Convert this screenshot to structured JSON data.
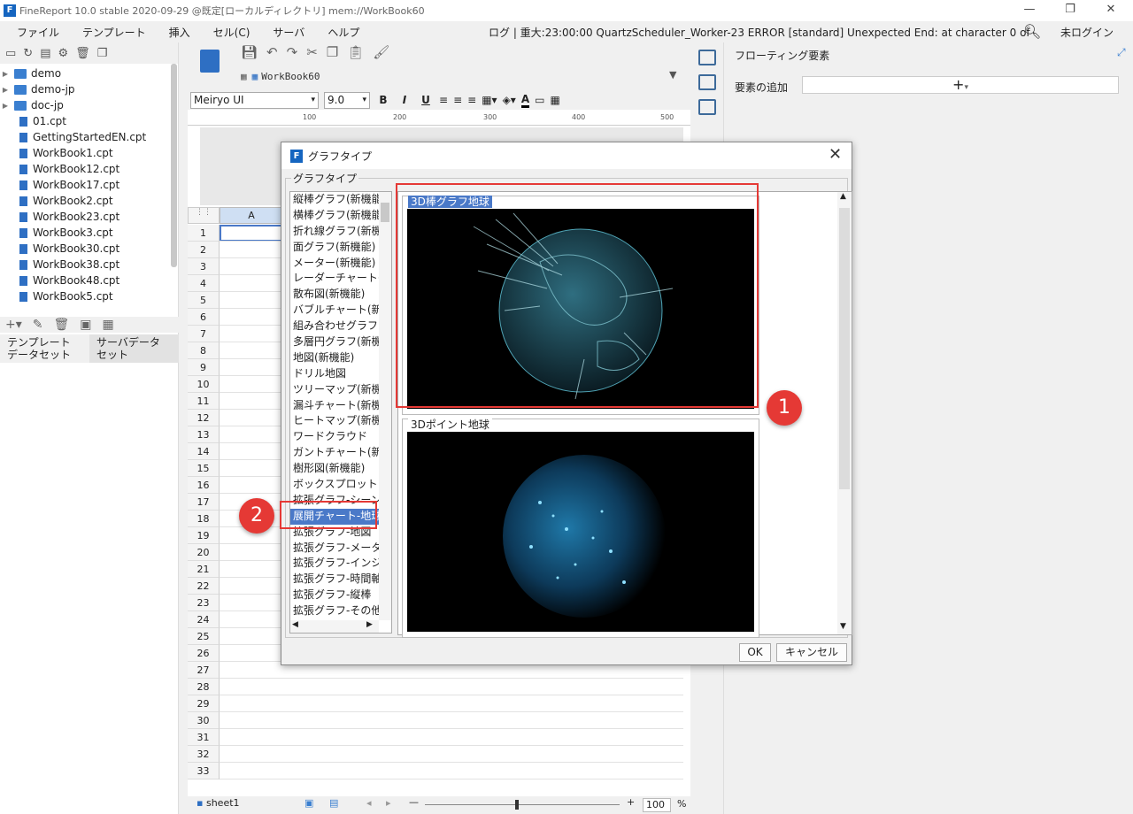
{
  "app": {
    "title": "FineReport 10.0 stable 2020-09-29 @既定[ローカルディレクトリ]    mem://WorkBook60",
    "min_symbol": "—",
    "max_symbol": "❐",
    "close_symbol": "✕"
  },
  "menu": {
    "items": [
      "ファイル",
      "テンプレート",
      "挿入",
      "セル(C)",
      "サーバ",
      "ヘルプ"
    ],
    "log": "ログ | 重大:23:00:00 QuartzScheduler_Worker-23 ERROR [standard] Unexpected End: at character 0 of",
    "login": "未ログイン"
  },
  "tree": {
    "folders": [
      "demo",
      "demo-jp",
      "doc-jp"
    ],
    "files": [
      "01.cpt",
      "GettingStartedEN.cpt",
      "WorkBook1.cpt",
      "WorkBook12.cpt",
      "WorkBook17.cpt",
      "WorkBook2.cpt",
      "WorkBook23.cpt",
      "WorkBook3.cpt",
      "WorkBook30.cpt",
      "WorkBook38.cpt",
      "WorkBook48.cpt",
      "WorkBook5.cpt"
    ]
  },
  "leftTabs": {
    "template_dataset": "テンプレート\nデータセット",
    "server_dataset": "サーバデータ\nセット"
  },
  "editor": {
    "workbook_tab": "WorkBook60",
    "font": "Meiryo UI",
    "font_size": "9.0",
    "bold": "B",
    "italic": "I",
    "underline": "U",
    "ruler_labels": [
      "100",
      "200",
      "300",
      "400",
      "500"
    ],
    "col_a": "A",
    "sheet": "sheet1",
    "zoom": "100",
    "zoom_unit": "%"
  },
  "rows": [
    "1",
    "2",
    "3",
    "4",
    "5",
    "6",
    "7",
    "8",
    "9",
    "10",
    "11",
    "12",
    "13",
    "14",
    "15",
    "16",
    "17",
    "18",
    "19",
    "20",
    "21",
    "22",
    "23",
    "24",
    "25",
    "26",
    "27",
    "28",
    "29",
    "30",
    "31",
    "32",
    "33"
  ],
  "right": {
    "title": "フローティング要素",
    "add_label": "要素の追加",
    "add_symbol": "+"
  },
  "dialog": {
    "title": "グラフタイプ",
    "group": "グラフタイプ",
    "types": [
      "縦棒グラフ(新機能)",
      "横棒グラフ(新機能)",
      "折れ線グラフ(新機能)",
      "面グラフ(新機能)",
      "メーター(新機能)",
      "レーダーチャート(新機能)",
      "散布図(新機能)",
      "バブルチャート(新機能)",
      "組み合わせグラフ(新機能)",
      "多層円グラフ(新機能)",
      "地図(新機能)",
      "ドリル地図",
      "ツリーマップ(新機能)",
      "漏斗チャート(新機能)",
      "ヒートマップ(新機能)",
      "ワードクラウド",
      "ガントチャート(新機能)",
      "樹形図(新機能)",
      "ボックスプロット",
      "拡張グラフ-シーン",
      "展開チャート-地球",
      "拡張グラフ-地図",
      "拡張グラフ-メーター",
      "拡張グラフ-インジケーター",
      "拡張グラフ-時間軸",
      "拡張グラフ-縦棒",
      "拡張グラフ-その他"
    ],
    "selected_index": 20,
    "previews": [
      "3D棒グラフ地球",
      "3Dポイント地球"
    ],
    "ok": "OK",
    "cancel": "キャンセル"
  },
  "annotations": [
    "1",
    "2"
  ],
  "colors": {
    "accent": "#4a79c8",
    "highlight": "#e53935",
    "brand": "#1565c0"
  }
}
